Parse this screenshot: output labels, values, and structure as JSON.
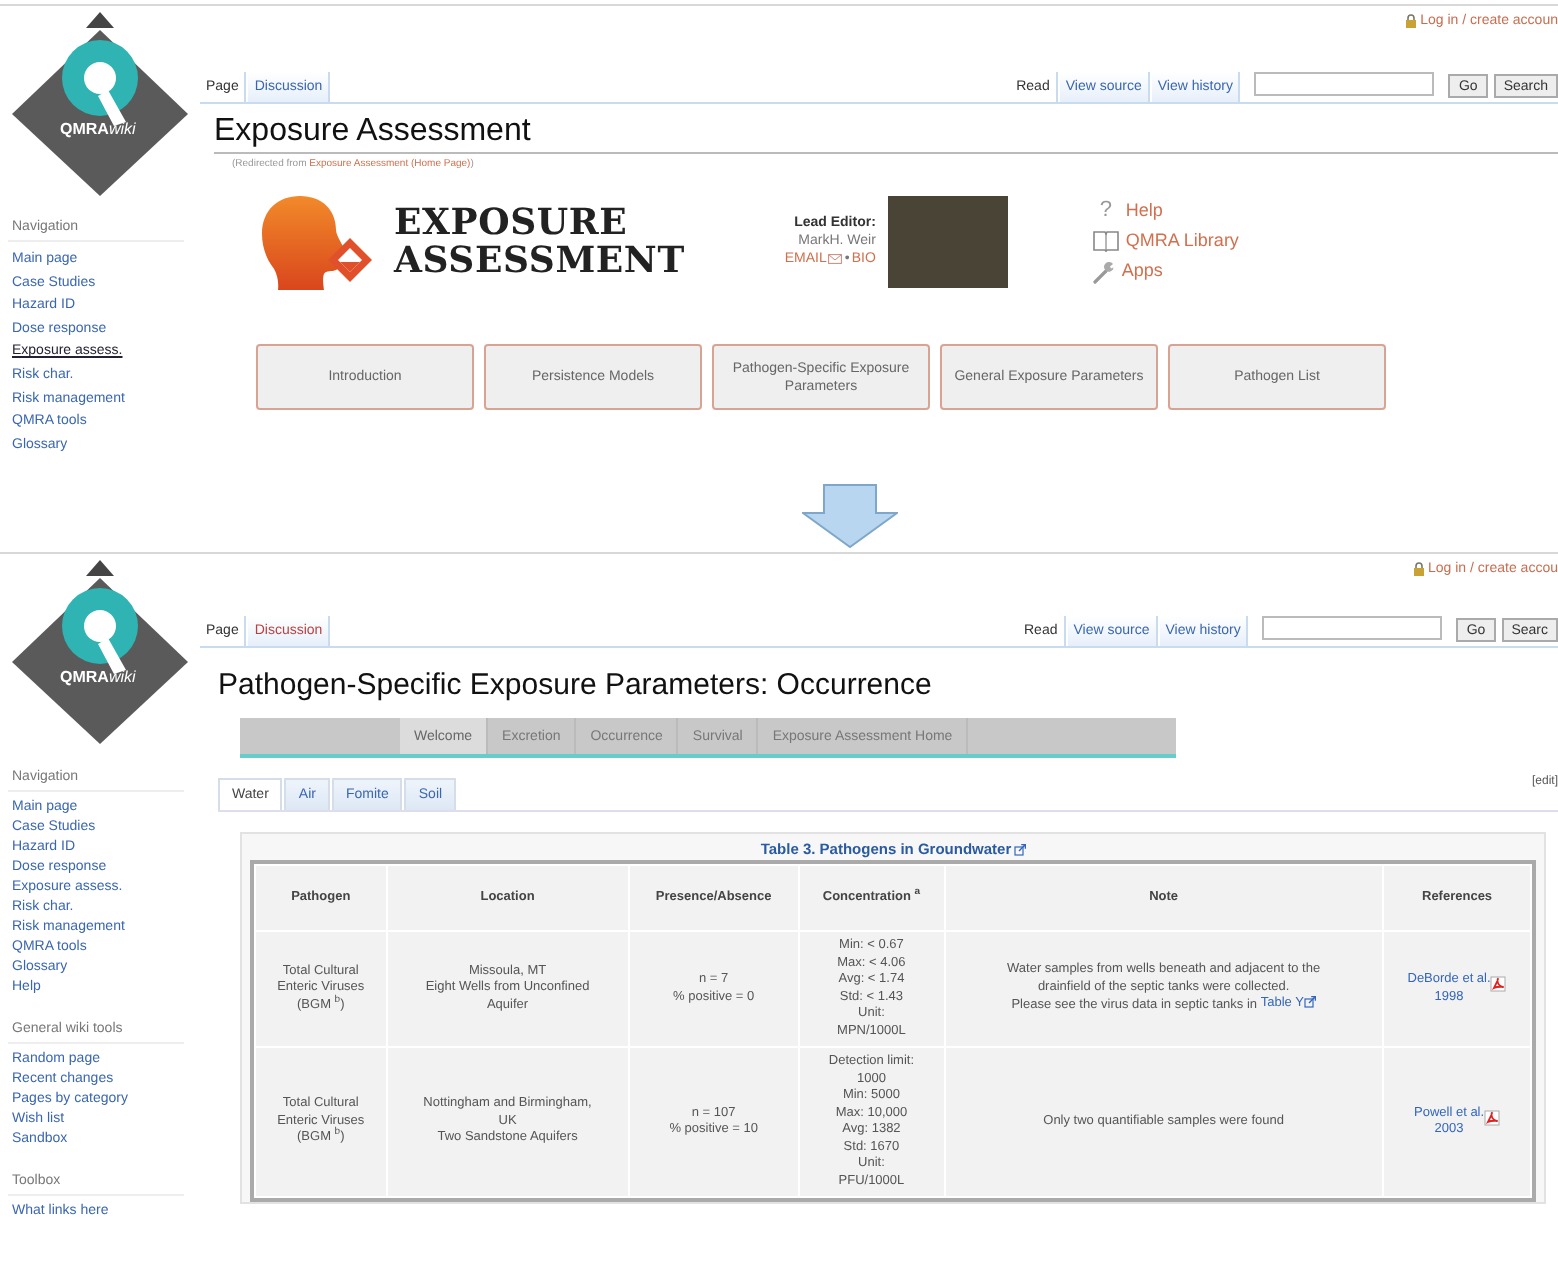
{
  "screens": [
    {
      "kind": "home",
      "user_link": "Log in / create accoun",
      "logo_text": "**QMRA**wiki",
      "sidebar": [
        {
          "heading": "Navigation",
          "items": [
            {
              "label": "Main page",
              "selected": false
            },
            {
              "label": "Case Studies",
              "selected": false
            },
            {
              "label": "Hazard ID",
              "selected": false
            },
            {
              "label": "Dose response",
              "selected": false
            },
            {
              "label": "Exposure assess.",
              "selected": true
            },
            {
              "label": "Risk char.",
              "selected": false
            },
            {
              "label": "Risk management",
              "selected": false
            },
            {
              "label": "QMRA tools",
              "selected": false
            },
            {
              "label": "Glossary",
              "selected": false
            }
          ]
        }
      ],
      "page_tabs": [
        {
          "label": "Page",
          "selected": true,
          "redlink": false
        },
        {
          "label": "Discussion",
          "selected": false,
          "redlink": false
        }
      ],
      "view_tabs": [
        {
          "label": "Read",
          "selected": true
        },
        {
          "label": "View source",
          "selected": false
        },
        {
          "label": "View history",
          "selected": false
        }
      ],
      "search": {
        "go": "Go",
        "search": "Search"
      },
      "title": "Exposure Assessment",
      "redirect": {
        "prefix": "(Redirected from ",
        "link": "Exposure Assessment (Home Page)",
        "suffix": ")"
      },
      "banner": {
        "title_lines": [
          "EXPOSURE",
          "ASSESSMENT"
        ],
        "editor_label": "Lead Editor:",
        "editor_name": "MarkH. Weir",
        "editor_links": [
          "EMAIL",
          "BIO"
        ],
        "separator": "•",
        "links": [
          {
            "kind": "help",
            "glyph": "?",
            "label": "Help"
          },
          {
            "kind": "library",
            "label": "QMRA Library"
          },
          {
            "kind": "apps",
            "label": "Apps"
          }
        ]
      },
      "buttons": [
        "Introduction",
        "Persistence Models",
        "Pathogen-Specific Exposure Parameters",
        "General Exposure Parameters",
        "Pathogen List"
      ]
    },
    {
      "kind": "occurrence",
      "user_link": "Log in / create accou",
      "logo_text": "**QMRA**wiki",
      "sidebar": [
        {
          "heading": "Navigation",
          "items": [
            {
              "label": "Main page",
              "selected": false
            },
            {
              "label": "Case Studies",
              "selected": false
            },
            {
              "label": "Hazard ID",
              "selected": false
            },
            {
              "label": "Dose response",
              "selected": false
            },
            {
              "label": "Exposure assess.",
              "selected": false
            },
            {
              "label": "Risk char.",
              "selected": false
            },
            {
              "label": "Risk management",
              "selected": false
            },
            {
              "label": "QMRA tools",
              "selected": false
            },
            {
              "label": "Glossary",
              "selected": false
            },
            {
              "label": "Help",
              "selected": false
            }
          ]
        },
        {
          "heading": "General wiki tools",
          "items": [
            {
              "label": "Random page",
              "selected": false
            },
            {
              "label": "Recent changes",
              "selected": false
            },
            {
              "label": "Pages by category",
              "selected": false
            },
            {
              "label": "Wish list",
              "selected": false
            },
            {
              "label": "Sandbox",
              "selected": false
            }
          ]
        },
        {
          "heading": "Toolbox",
          "items": [
            {
              "label": "What links here",
              "selected": false
            }
          ]
        }
      ],
      "page_tabs": [
        {
          "label": "Page",
          "selected": true,
          "redlink": false
        },
        {
          "label": "Discussion",
          "selected": false,
          "redlink": true
        }
      ],
      "view_tabs": [
        {
          "label": "Read",
          "selected": true
        },
        {
          "label": "View source",
          "selected": false
        },
        {
          "label": "View history",
          "selected": false
        }
      ],
      "search": {
        "go": "Go",
        "search": "Searc"
      },
      "title": "Pathogen-Specific Exposure Parameters: Occurrence",
      "section_nav": [
        {
          "label": "Welcome",
          "selected": true
        },
        {
          "label": "Excretion",
          "selected": false
        },
        {
          "label": "Occurrence",
          "selected": false
        },
        {
          "label": "Survival",
          "selected": false
        },
        {
          "label": "Exposure Assessment Home",
          "selected": false
        }
      ],
      "subtabs": [
        {
          "label": "Water",
          "selected": true
        },
        {
          "label": "Air",
          "selected": false
        },
        {
          "label": "Fomite",
          "selected": false
        },
        {
          "label": "Soil",
          "selected": false
        }
      ],
      "edit_link": "[edit]",
      "table": {
        "caption": "Table 3. Pathogens in Groundwater",
        "columns": [
          "Pathogen",
          "Location",
          "Presence/Absence",
          "Concentration $^{a}$",
          "Note",
          "References"
        ],
        "rows": [
          {
            "pathogen": "Total Cultural\nEnteric Viruses\n(BGM $^{b}$)",
            "location": "Missoula, MT\nEight Wells from Unconfined\nAquifer",
            "presence": "n = 7\n% positive = 0",
            "concentration": "Min: < 0.67\nMax: < 4.06\nAvg: < 1.74\nStd: < 1.43\nUnit:\nMPN/1000L",
            "note": {
              "text": "Water samples from wells beneath and adjacent to the\ndrainfield of the septic tanks were collected.\nPlease see the virus data in septic tanks in ",
              "link": "Table Y"
            },
            "reference": "DeBorde et al.\n1998"
          },
          {
            "pathogen": "Total Cultural\nEnteric Viruses\n(BGM $^{b}$)",
            "location": "Nottingham and Birmingham,\nUK\nTwo Sandstone Aquifers",
            "presence": "n = 107\n% positive = 10",
            "concentration": "Detection limit:\n1000\nMin: 5000\nMax: 10,000\nAvg: 1382\nStd: 1670\nUnit:\nPFU/1000L",
            "note": {
              "text": "Only two quantifiable samples were found"
            },
            "reference": "Powell et al.\n2003"
          }
        ]
      }
    }
  ]
}
